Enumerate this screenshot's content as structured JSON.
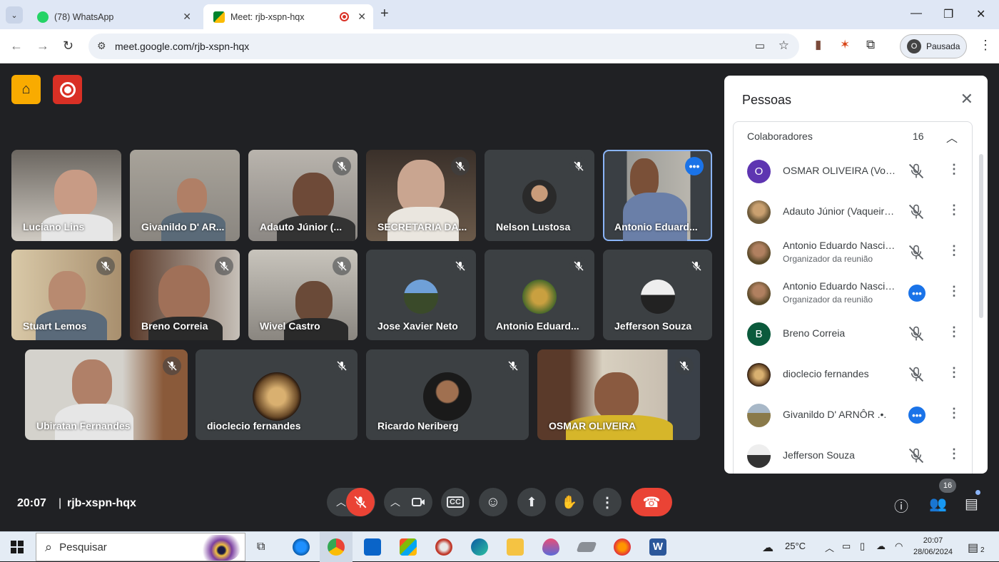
{
  "browser": {
    "tabs": [
      {
        "title": "(78) WhatsApp"
      },
      {
        "title": "Meet: rjb-xspn-hqx"
      }
    ],
    "url": "meet.google.com/rjb-xspn-hqx",
    "profile": {
      "initial": "O",
      "label": "Pausada"
    }
  },
  "meeting": {
    "time": "20:07",
    "code": "rjb-xspn-hqx",
    "people_badge": "16",
    "tiles": [
      {
        "name": "Luciano Lins"
      },
      {
        "name": "Givanildo D' AR..."
      },
      {
        "name": "Adauto Júnior (..."
      },
      {
        "name": "SECRETARIA DA..."
      },
      {
        "name": "Nelson Lustosa"
      },
      {
        "name": "Antonio Eduard..."
      },
      {
        "name": "Stuart Lemos"
      },
      {
        "name": "Breno Correia"
      },
      {
        "name": "Wivel Castro"
      },
      {
        "name": "Jose Xavier Neto"
      },
      {
        "name": "Antonio Eduard..."
      },
      {
        "name": "Jefferson Souza"
      },
      {
        "name": "Ubiratan Fernandes"
      },
      {
        "name": "dioclecio fernandes"
      },
      {
        "name": "Ricardo Neriberg"
      },
      {
        "name": "OSMAR OLIVEIRA"
      }
    ]
  },
  "people_panel": {
    "title": "Pessoas",
    "section_label": "Colaboradores",
    "section_count": "16",
    "people": [
      {
        "name": "OSMAR OLIVEIRA (Você)",
        "initial": "O",
        "color": "#5e35b1",
        "subtitle": ""
      },
      {
        "name": "Adauto Júnior (Vaqueiro...)",
        "initial": "",
        "color": "#6d5a3a",
        "subtitle": ""
      },
      {
        "name": "Antonio Eduardo Nascimento",
        "initial": "",
        "color": "#7a6040",
        "subtitle": "Organizador da reunião"
      },
      {
        "name": "Antonio Eduardo Nascimento",
        "initial": "",
        "color": "#7a6040",
        "subtitle": "Organizador da reunião"
      },
      {
        "name": "Breno Correia",
        "initial": "B",
        "color": "#0b5a3c",
        "subtitle": ""
      },
      {
        "name": "dioclecio fernandes",
        "initial": "",
        "color": "#8a6a3a",
        "subtitle": ""
      },
      {
        "name": "Givanildo D' ARNÔR .•.",
        "initial": "",
        "color": "#8a7a4a",
        "subtitle": ""
      },
      {
        "name": "Jefferson Souza",
        "initial": "",
        "color": "#444444",
        "subtitle": ""
      }
    ]
  },
  "taskbar": {
    "search_placeholder": "Pesquisar",
    "temperature": "25°C",
    "time": "20:07",
    "date": "28/06/2024",
    "notifications": "2"
  }
}
